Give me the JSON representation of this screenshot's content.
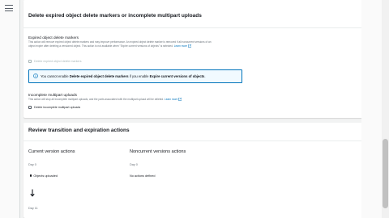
{
  "nav": {
    "menu_icon": "hamburger-icon"
  },
  "delete_markers_card": {
    "title": "Delete expired object delete markers or incomplete multipart uploads",
    "expired_markers": {
      "label": "Expired object delete markers",
      "description": "This action will remove expired object delete markers and may improve performance. An expired object delete marker is removed if all noncurrent versions of an object expire after deleting a versioned object. This action is not available when \"Expire current versions of objects\" is selected.",
      "learn_more": "Learn more",
      "checkbox_label": "Delete expired object delete markers"
    },
    "alert": {
      "prefix": "You cannot enable ",
      "action": "Delete expired object delete markers",
      "middle": " if you enable ",
      "conflict": "Expire current versions of objects",
      "suffix": "."
    },
    "incomplete_uploads": {
      "label": "Incomplete multipart uploads",
      "description": "This action will stop all incomplete multipart uploads, and the parts associated with the multipart upload will be deleted.",
      "learn_more": "Learn more",
      "checkbox_label": "Delete incomplete multipart uploads"
    }
  },
  "review_card": {
    "title": "Review transition and expiration actions",
    "current": {
      "heading": "Current version actions",
      "day_start": "Day 0",
      "event": "Objects uploaded",
      "day_next": "Day 11"
    },
    "noncurrent": {
      "heading": "Noncurrent versions actions",
      "day_start": "Day 0",
      "event": "No actions defined"
    }
  },
  "colors": {
    "link": "#0073bb",
    "alert_border": "#0073bb",
    "alert_bg": "#f1faff"
  }
}
